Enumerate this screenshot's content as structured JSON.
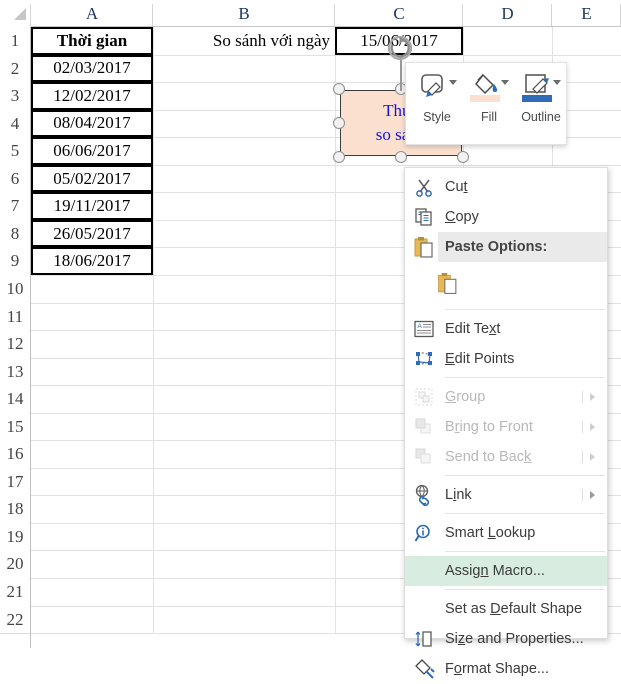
{
  "app": "excel-worksheet",
  "grid": {
    "columns": [
      "A",
      "B",
      "C",
      "D",
      "E"
    ],
    "rows": [
      "1",
      "2",
      "3",
      "4",
      "5",
      "6",
      "7",
      "8",
      "9",
      "10",
      "11",
      "12",
      "13",
      "14",
      "15",
      "16",
      "17",
      "18",
      "19",
      "20",
      "21",
      "22"
    ],
    "cells": {
      "A1": "Thời gian",
      "A2": "02/03/2017",
      "A3": "12/02/2017",
      "A4": "08/04/2017",
      "A5": "06/06/2017",
      "A6": "05/02/2017",
      "A7": "19/11/2017",
      "A8": "26/05/2017",
      "A9": "18/06/2017",
      "B1": "So sánh với ngày",
      "C1": "15/06/2017"
    }
  },
  "shape": {
    "name": "rounded-rectangle-shape",
    "text_line1": "Thực",
    "text_line2": "so sánh",
    "fill_color": "#fbe0cf",
    "text_color": "#1414d8",
    "outline_color": "#3c3c3c"
  },
  "mini_toolbar": {
    "items": [
      {
        "icon": "shape-style-icon",
        "label": "Style",
        "swatch": ""
      },
      {
        "icon": "fill-bucket-icon",
        "label": "Fill",
        "swatch": "#fbe0cf"
      },
      {
        "icon": "outline-pencil-icon",
        "label": "Outline",
        "swatch": "#2e6cb5"
      }
    ]
  },
  "context_menu": {
    "items": [
      {
        "label": "Cut",
        "icon": "scissors-icon",
        "accel": "t",
        "state": "normal",
        "submenu": false,
        "separator_after": false
      },
      {
        "label": "Copy",
        "icon": "copy-icon",
        "accel": "C",
        "state": "normal",
        "submenu": false,
        "separator_after": false
      },
      {
        "label": "Paste Options:",
        "icon": "paste-icon",
        "accel": "",
        "state": "header",
        "submenu": false,
        "separator_after": false
      },
      {
        "label": "",
        "icon": "paste-keep-source-icon",
        "accel": "",
        "state": "gallery",
        "submenu": false,
        "separator_after": true
      },
      {
        "label": "Edit Text",
        "icon": "edit-text-icon",
        "accel": "x",
        "state": "normal",
        "submenu": false,
        "separator_after": false
      },
      {
        "label": "Edit Points",
        "icon": "edit-points-icon",
        "accel": "E",
        "state": "normal",
        "submenu": false,
        "separator_after": true
      },
      {
        "label": "Group",
        "icon": "group-icon",
        "accel": "G",
        "state": "disabled",
        "submenu": true,
        "separator_after": false
      },
      {
        "label": "Bring to Front",
        "icon": "bring-to-front-icon",
        "accel": "r",
        "state": "disabled",
        "submenu": true,
        "separator_after": false
      },
      {
        "label": "Send to Back",
        "icon": "send-to-back-icon",
        "accel": "k",
        "state": "disabled",
        "submenu": true,
        "separator_after": true
      },
      {
        "label": "Link",
        "icon": "link-icon",
        "accel": "i",
        "state": "normal",
        "submenu": true,
        "separator_after": true
      },
      {
        "label": "Smart Lookup",
        "icon": "smart-lookup-icon",
        "accel": "L",
        "state": "normal",
        "submenu": false,
        "separator_after": true
      },
      {
        "label": "Assign Macro...",
        "icon": "",
        "accel": "n",
        "state": "highlighted",
        "submenu": false,
        "separator_after": true
      },
      {
        "label": "Set as Default Shape",
        "icon": "",
        "accel": "D",
        "state": "normal",
        "submenu": false,
        "separator_after": false
      },
      {
        "label": "Size and Properties...",
        "icon": "size-properties-icon",
        "accel": "z",
        "state": "normal",
        "submenu": false,
        "separator_after": false
      },
      {
        "label": "Format Shape...",
        "icon": "format-shape-icon",
        "accel": "o",
        "state": "normal",
        "submenu": false,
        "separator_after": false
      }
    ],
    "highlight_color": "#d9ece0",
    "header_highlight_color": "#eaeaea"
  }
}
